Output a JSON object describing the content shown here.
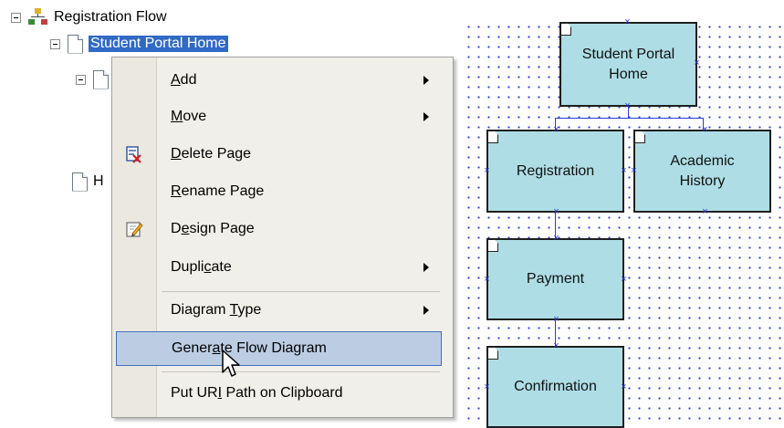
{
  "tree": {
    "root_label": "Registration Flow",
    "selected_label": "Student Portal Home",
    "partial_label": "H"
  },
  "menu": {
    "items": [
      {
        "label": "Add",
        "mnemonic": "A",
        "submenu": true
      },
      {
        "label": "Move",
        "mnemonic": "M",
        "submenu": true
      },
      {
        "label": "Delete Page",
        "mnemonic": "D",
        "icon": "delete-page-icon"
      },
      {
        "label": "Rename Page",
        "mnemonic": "R"
      },
      {
        "label": "Design Page",
        "mnemonic": "e",
        "icon": "design-page-icon"
      },
      {
        "label": "Duplicate",
        "mnemonic": "c",
        "submenu": true
      },
      {
        "label": "Diagram Type",
        "mnemonic": "T",
        "submenu": true
      },
      {
        "label": "Generate Flow Diagram",
        "mnemonic": "a",
        "highlighted": true
      },
      {
        "label": "Put URI Path on Clipboard",
        "mnemonic": "I"
      }
    ]
  },
  "diagram": {
    "nodes": [
      {
        "label": "Student Portal Home"
      },
      {
        "label": "Registration"
      },
      {
        "label": "Academic History"
      },
      {
        "label": "Payment"
      },
      {
        "label": "Confirmation"
      }
    ]
  },
  "colors": {
    "selection": "#316ac5",
    "node_fill": "#aedde5",
    "connector": "#2a3bd6",
    "menu_highlight": "#bccde3"
  }
}
